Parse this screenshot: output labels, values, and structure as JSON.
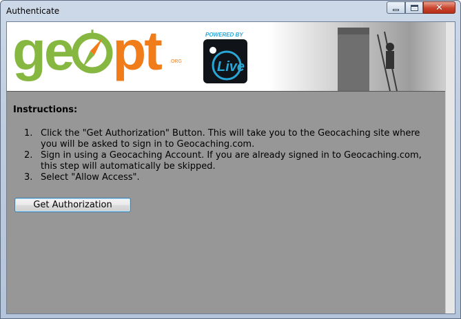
{
  "window": {
    "title": "Authenticate"
  },
  "banner": {
    "logo_ge": "ge",
    "logo_pt": "pt",
    "logo_org": ".ORG",
    "powered_by": "POWERED BY",
    "live_label": "Live"
  },
  "instructions": {
    "heading": "Instructions:",
    "steps": [
      {
        "number": "1.",
        "text": "Click the \"Get Authorization\" Button. This will take you to the Geocaching site where you will be asked to sign in to Geocaching.com."
      },
      {
        "number": "2.",
        "text": "Sign in using a Geocaching Account. If you are already signed in to Geocaching.com, this step will automatically be skipped."
      },
      {
        "number": "3.",
        "text": "Select \"Allow Access\"."
      }
    ]
  },
  "actions": {
    "get_authorization_label": "Get Authorization"
  },
  "colors": {
    "client_bg": "#979797",
    "logo_green": "#86b741",
    "logo_orange": "#f07d1a",
    "live_blue": "#2aa6d6"
  }
}
